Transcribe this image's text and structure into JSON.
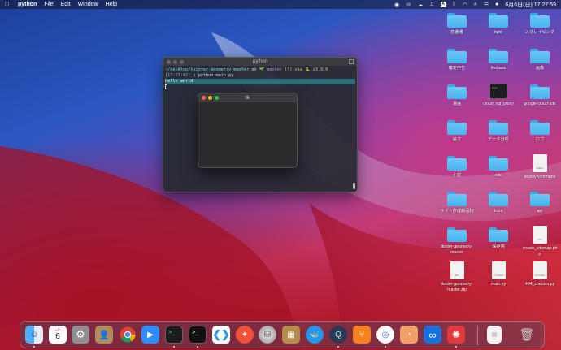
{
  "menubar": {
    "apple": "",
    "app_name": "python",
    "menus": [
      "File",
      "Edit",
      "Window",
      "Help"
    ],
    "clock": "6月6日(日) 17:27:59",
    "status_icons": [
      "record-icon",
      "creative-cloud-icon",
      "cloud-icon",
      "music-icon",
      "input-a-icon",
      "bluetooth-icon",
      "wifi-icon",
      "search-icon",
      "control-center-icon",
      "notification-icon"
    ]
  },
  "terminal": {
    "title": "python",
    "prompt_path": "~/desktop/tkinter-geometry-master",
    "on": " on ",
    "branch": "master",
    "branch_status": " [!] via ",
    "py_version": "v3.9.0",
    "time": "[17:27:42]",
    "command": "python main.py",
    "output": "hello world"
  },
  "tk_window": {
    "title": "tk"
  },
  "desktop": {
    "icons": [
      {
        "label": "読書書",
        "type": "folder"
      },
      {
        "label": "light",
        "type": "folder"
      },
      {
        "label": "スクレイピング",
        "type": "folder"
      },
      {
        "label": "確定申告",
        "type": "folder"
      },
      {
        "label": "firebase",
        "type": "folder"
      },
      {
        "label": "画像",
        "type": "folder"
      },
      {
        "label": "漫画",
        "type": "folder"
      },
      {
        "label": "cloud_sql_proxy",
        "type": "exe",
        "tag": "exec"
      },
      {
        "label": "google-cloud-sdk",
        "type": "folder"
      },
      {
        "label": "論文",
        "type": "folder"
      },
      {
        "label": "データ分析",
        "type": "folder"
      },
      {
        "label": "ロゴ",
        "type": "folder"
      },
      {
        "label": "小説",
        "type": "folder"
      },
      {
        "label": "site",
        "type": "folder"
      },
      {
        "label": "deploy.command",
        "type": "doc",
        "tag": "SHELL"
      },
      {
        "label": "サイト作成納品物",
        "type": "folder"
      },
      {
        "label": "front",
        "type": "folder"
      },
      {
        "label": "api",
        "type": "folder"
      },
      {
        "label": "tkinter-geometry-\nmaster",
        "type": "folder"
      },
      {
        "label": "保存用",
        "type": "folder"
      },
      {
        "label": "create_sitemap.ph\np",
        "type": "doc",
        "tag": "PHP"
      },
      {
        "label": "tkinter-geometry-\nmaster.zip",
        "type": "doc",
        "tag": "ZIP"
      },
      {
        "label": "main.py",
        "type": "doc",
        "tag": "PYTHON"
      },
      {
        "label": "404_checker.py",
        "type": "doc",
        "tag": "PYTHON"
      }
    ]
  },
  "dock": {
    "calendar_month": "6月",
    "calendar_day": "6",
    "apps": [
      "finder-icon",
      "calendar-icon",
      "system-preferences-icon",
      "contacts-icon",
      "chrome-icon",
      "zoom-icon",
      "terminal-icon",
      "iterm-icon",
      "vscode-icon",
      "swift-icon",
      "sequel-ace-icon",
      "archive-utility-icon",
      "docker-icon",
      "quicktime-icon",
      "sourcetree-icon",
      "app-icon",
      "preview-icon",
      "infinity-icon",
      "clock-app-icon",
      "document-icon",
      "trash-icon"
    ],
    "colors": {
      "finder": "#2b8cf0",
      "chrome": "#e8e8e8",
      "zoom": "#2d8cff",
      "vscode": "#1f9cf0",
      "swift": "#f05138",
      "docker": "#2496ed",
      "sourcetree": "#f4821f",
      "infinity": "#1670e0",
      "clock": "#e23a3a"
    }
  }
}
